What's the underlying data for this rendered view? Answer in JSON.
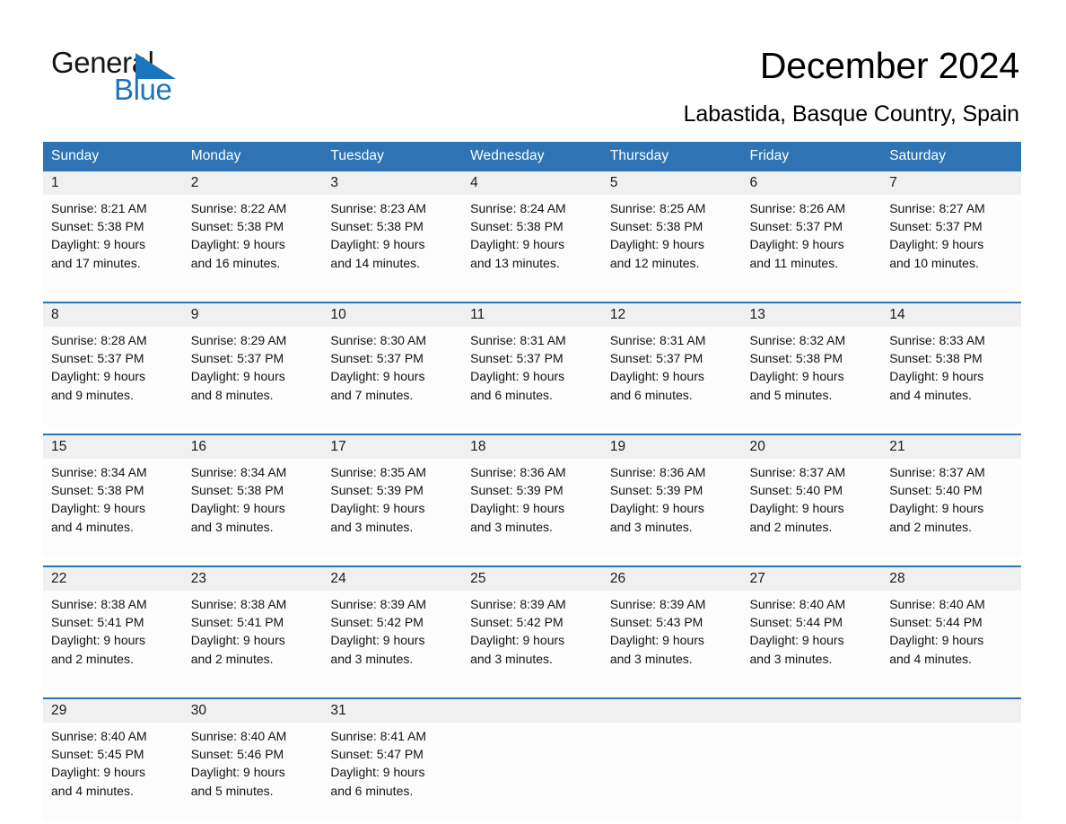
{
  "brand": {
    "name_part1": "General",
    "name_part2": "Blue",
    "triangle_icon": "triangle-icon",
    "color_black": "#161616",
    "color_blue": "#1C75BC"
  },
  "header": {
    "title": "December 2024",
    "subtitle": "Labastida, Basque Country, Spain"
  },
  "theme": {
    "header_bar": "#2E74B5",
    "daynum_band": "#F0F0F0",
    "cell_bg": "#FCFCFC",
    "separator": "#2E74B5"
  },
  "calendar": {
    "weekday_headers": [
      "Sunday",
      "Monday",
      "Tuesday",
      "Wednesday",
      "Thursday",
      "Friday",
      "Saturday"
    ],
    "weeks": [
      {
        "days": [
          {
            "num": "1",
            "sunrise": "Sunrise: 8:21 AM",
            "sunset": "Sunset: 5:38 PM",
            "daylight_line1": "Daylight: 9 hours",
            "daylight_line2": "and 17 minutes."
          },
          {
            "num": "2",
            "sunrise": "Sunrise: 8:22 AM",
            "sunset": "Sunset: 5:38 PM",
            "daylight_line1": "Daylight: 9 hours",
            "daylight_line2": "and 16 minutes."
          },
          {
            "num": "3",
            "sunrise": "Sunrise: 8:23 AM",
            "sunset": "Sunset: 5:38 PM",
            "daylight_line1": "Daylight: 9 hours",
            "daylight_line2": "and 14 minutes."
          },
          {
            "num": "4",
            "sunrise": "Sunrise: 8:24 AM",
            "sunset": "Sunset: 5:38 PM",
            "daylight_line1": "Daylight: 9 hours",
            "daylight_line2": "and 13 minutes."
          },
          {
            "num": "5",
            "sunrise": "Sunrise: 8:25 AM",
            "sunset": "Sunset: 5:38 PM",
            "daylight_line1": "Daylight: 9 hours",
            "daylight_line2": "and 12 minutes."
          },
          {
            "num": "6",
            "sunrise": "Sunrise: 8:26 AM",
            "sunset": "Sunset: 5:37 PM",
            "daylight_line1": "Daylight: 9 hours",
            "daylight_line2": "and 11 minutes."
          },
          {
            "num": "7",
            "sunrise": "Sunrise: 8:27 AM",
            "sunset": "Sunset: 5:37 PM",
            "daylight_line1": "Daylight: 9 hours",
            "daylight_line2": "and 10 minutes."
          }
        ]
      },
      {
        "days": [
          {
            "num": "8",
            "sunrise": "Sunrise: 8:28 AM",
            "sunset": "Sunset: 5:37 PM",
            "daylight_line1": "Daylight: 9 hours",
            "daylight_line2": "and 9 minutes."
          },
          {
            "num": "9",
            "sunrise": "Sunrise: 8:29 AM",
            "sunset": "Sunset: 5:37 PM",
            "daylight_line1": "Daylight: 9 hours",
            "daylight_line2": "and 8 minutes."
          },
          {
            "num": "10",
            "sunrise": "Sunrise: 8:30 AM",
            "sunset": "Sunset: 5:37 PM",
            "daylight_line1": "Daylight: 9 hours",
            "daylight_line2": "and 7 minutes."
          },
          {
            "num": "11",
            "sunrise": "Sunrise: 8:31 AM",
            "sunset": "Sunset: 5:37 PM",
            "daylight_line1": "Daylight: 9 hours",
            "daylight_line2": "and 6 minutes."
          },
          {
            "num": "12",
            "sunrise": "Sunrise: 8:31 AM",
            "sunset": "Sunset: 5:37 PM",
            "daylight_line1": "Daylight: 9 hours",
            "daylight_line2": "and 6 minutes."
          },
          {
            "num": "13",
            "sunrise": "Sunrise: 8:32 AM",
            "sunset": "Sunset: 5:38 PM",
            "daylight_line1": "Daylight: 9 hours",
            "daylight_line2": "and 5 minutes."
          },
          {
            "num": "14",
            "sunrise": "Sunrise: 8:33 AM",
            "sunset": "Sunset: 5:38 PM",
            "daylight_line1": "Daylight: 9 hours",
            "daylight_line2": "and 4 minutes."
          }
        ]
      },
      {
        "days": [
          {
            "num": "15",
            "sunrise": "Sunrise: 8:34 AM",
            "sunset": "Sunset: 5:38 PM",
            "daylight_line1": "Daylight: 9 hours",
            "daylight_line2": "and 4 minutes."
          },
          {
            "num": "16",
            "sunrise": "Sunrise: 8:34 AM",
            "sunset": "Sunset: 5:38 PM",
            "daylight_line1": "Daylight: 9 hours",
            "daylight_line2": "and 3 minutes."
          },
          {
            "num": "17",
            "sunrise": "Sunrise: 8:35 AM",
            "sunset": "Sunset: 5:39 PM",
            "daylight_line1": "Daylight: 9 hours",
            "daylight_line2": "and 3 minutes."
          },
          {
            "num": "18",
            "sunrise": "Sunrise: 8:36 AM",
            "sunset": "Sunset: 5:39 PM",
            "daylight_line1": "Daylight: 9 hours",
            "daylight_line2": "and 3 minutes."
          },
          {
            "num": "19",
            "sunrise": "Sunrise: 8:36 AM",
            "sunset": "Sunset: 5:39 PM",
            "daylight_line1": "Daylight: 9 hours",
            "daylight_line2": "and 3 minutes."
          },
          {
            "num": "20",
            "sunrise": "Sunrise: 8:37 AM",
            "sunset": "Sunset: 5:40 PM",
            "daylight_line1": "Daylight: 9 hours",
            "daylight_line2": "and 2 minutes."
          },
          {
            "num": "21",
            "sunrise": "Sunrise: 8:37 AM",
            "sunset": "Sunset: 5:40 PM",
            "daylight_line1": "Daylight: 9 hours",
            "daylight_line2": "and 2 minutes."
          }
        ]
      },
      {
        "days": [
          {
            "num": "22",
            "sunrise": "Sunrise: 8:38 AM",
            "sunset": "Sunset: 5:41 PM",
            "daylight_line1": "Daylight: 9 hours",
            "daylight_line2": "and 2 minutes."
          },
          {
            "num": "23",
            "sunrise": "Sunrise: 8:38 AM",
            "sunset": "Sunset: 5:41 PM",
            "daylight_line1": "Daylight: 9 hours",
            "daylight_line2": "and 2 minutes."
          },
          {
            "num": "24",
            "sunrise": "Sunrise: 8:39 AM",
            "sunset": "Sunset: 5:42 PM",
            "daylight_line1": "Daylight: 9 hours",
            "daylight_line2": "and 3 minutes."
          },
          {
            "num": "25",
            "sunrise": "Sunrise: 8:39 AM",
            "sunset": "Sunset: 5:42 PM",
            "daylight_line1": "Daylight: 9 hours",
            "daylight_line2": "and 3 minutes."
          },
          {
            "num": "26",
            "sunrise": "Sunrise: 8:39 AM",
            "sunset": "Sunset: 5:43 PM",
            "daylight_line1": "Daylight: 9 hours",
            "daylight_line2": "and 3 minutes."
          },
          {
            "num": "27",
            "sunrise": "Sunrise: 8:40 AM",
            "sunset": "Sunset: 5:44 PM",
            "daylight_line1": "Daylight: 9 hours",
            "daylight_line2": "and 3 minutes."
          },
          {
            "num": "28",
            "sunrise": "Sunrise: 8:40 AM",
            "sunset": "Sunset: 5:44 PM",
            "daylight_line1": "Daylight: 9 hours",
            "daylight_line2": "and 4 minutes."
          }
        ]
      },
      {
        "days": [
          {
            "num": "29",
            "sunrise": "Sunrise: 8:40 AM",
            "sunset": "Sunset: 5:45 PM",
            "daylight_line1": "Daylight: 9 hours",
            "daylight_line2": "and 4 minutes."
          },
          {
            "num": "30",
            "sunrise": "Sunrise: 8:40 AM",
            "sunset": "Sunset: 5:46 PM",
            "daylight_line1": "Daylight: 9 hours",
            "daylight_line2": "and 5 minutes."
          },
          {
            "num": "31",
            "sunrise": "Sunrise: 8:41 AM",
            "sunset": "Sunset: 5:47 PM",
            "daylight_line1": "Daylight: 9 hours",
            "daylight_line2": "and 6 minutes."
          },
          {
            "num": "",
            "sunrise": "",
            "sunset": "",
            "daylight_line1": "",
            "daylight_line2": ""
          },
          {
            "num": "",
            "sunrise": "",
            "sunset": "",
            "daylight_line1": "",
            "daylight_line2": ""
          },
          {
            "num": "",
            "sunrise": "",
            "sunset": "",
            "daylight_line1": "",
            "daylight_line2": ""
          },
          {
            "num": "",
            "sunrise": "",
            "sunset": "",
            "daylight_line1": "",
            "daylight_line2": ""
          }
        ]
      }
    ]
  }
}
